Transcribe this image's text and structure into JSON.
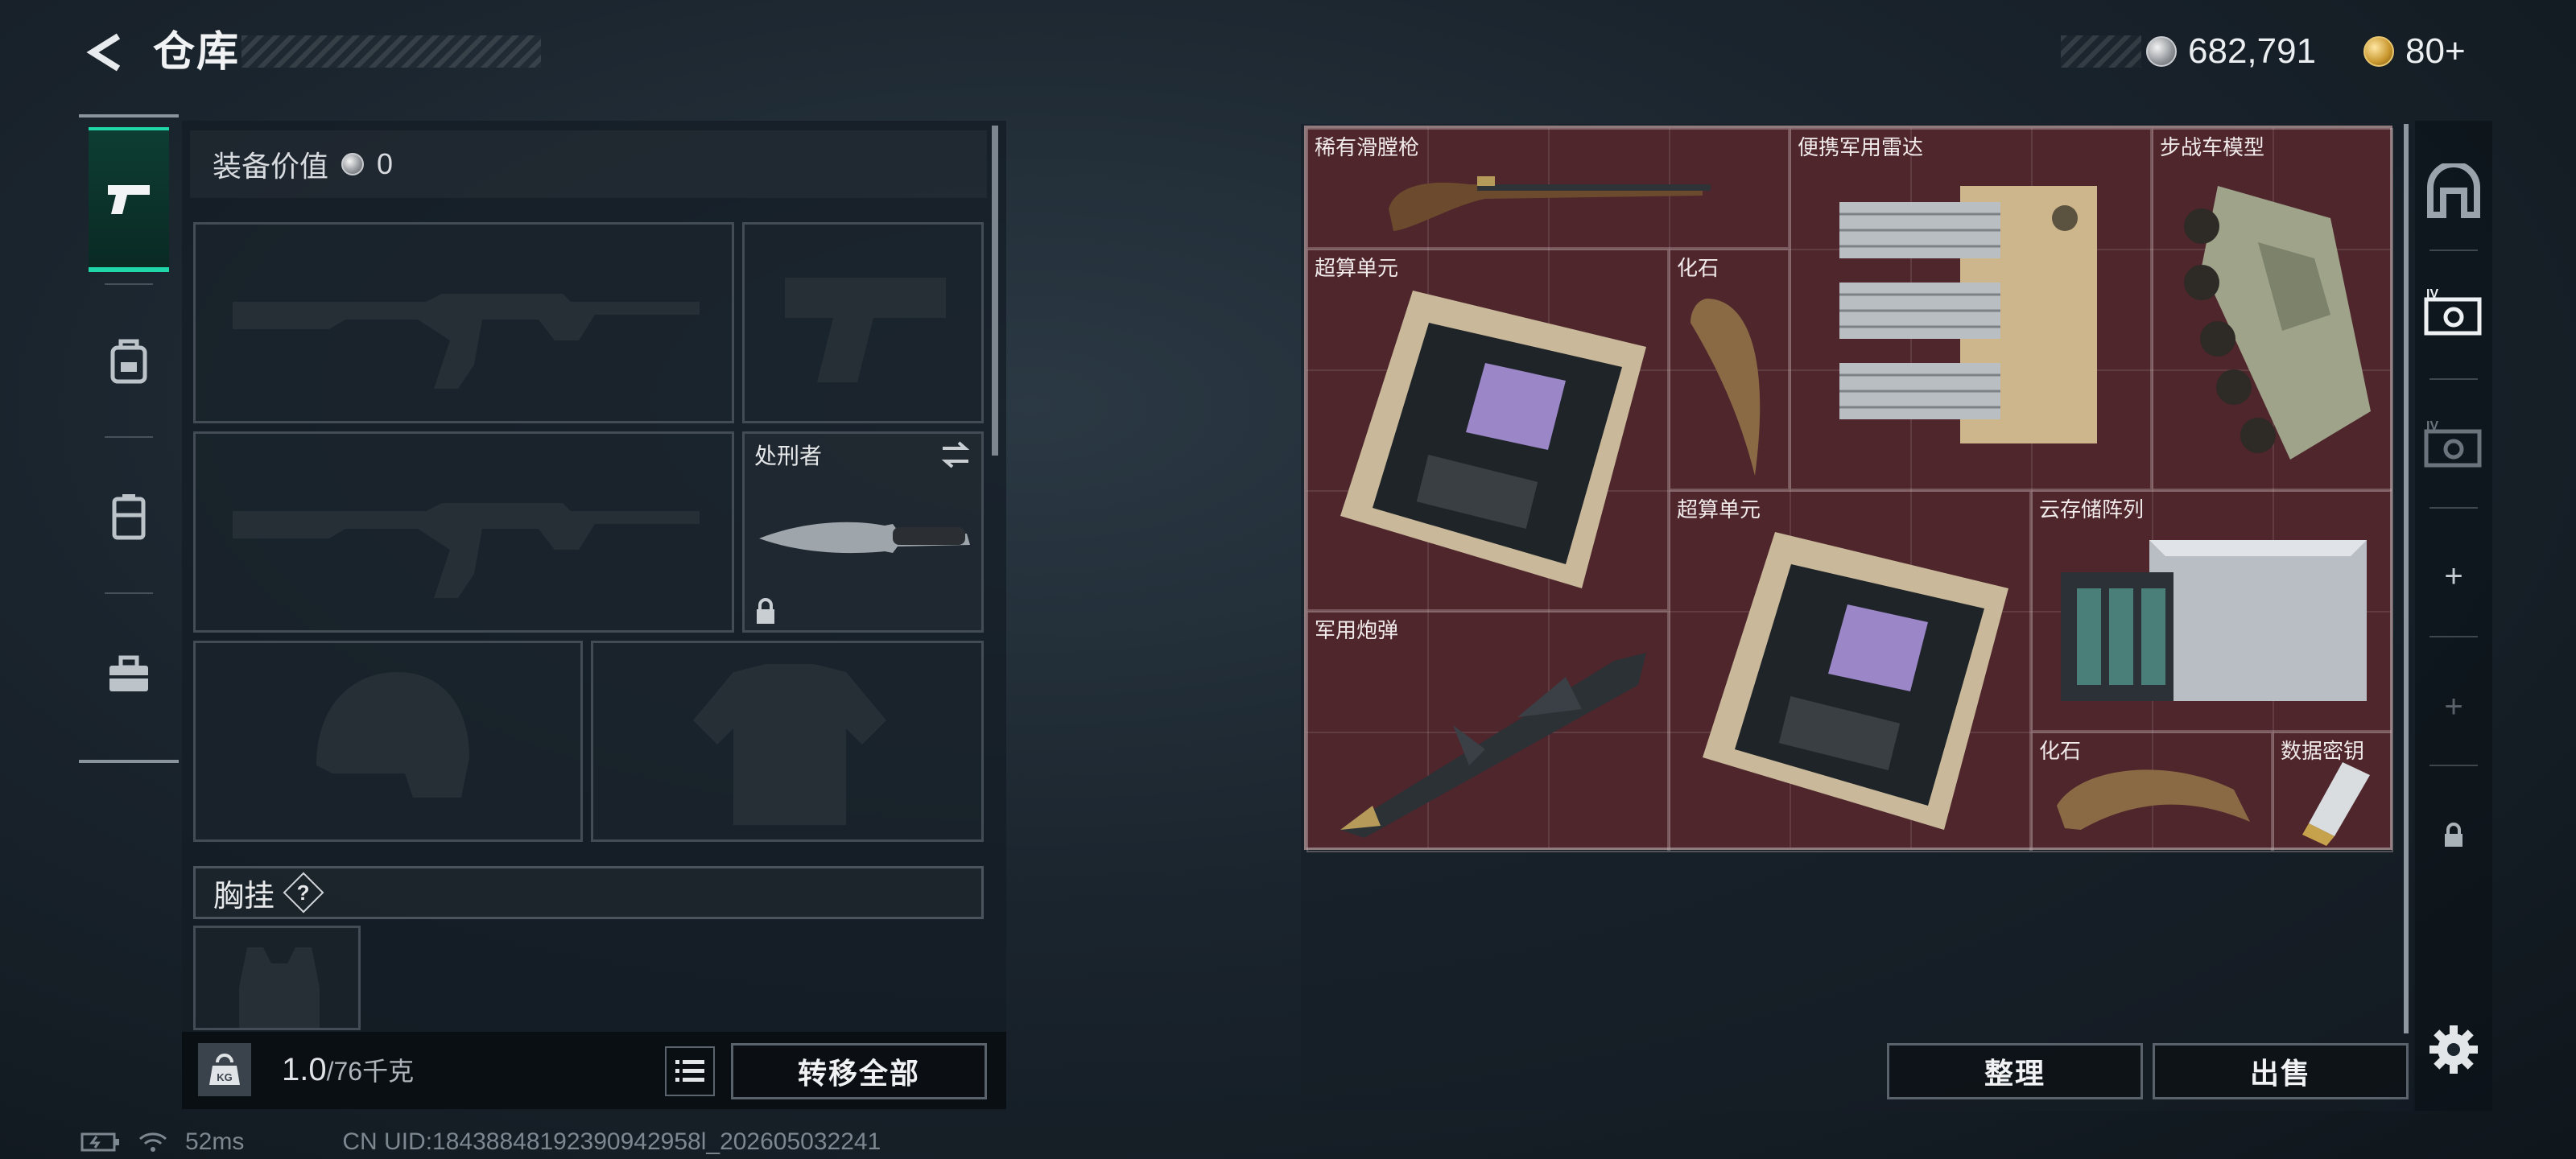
{
  "header": {
    "title": "仓库",
    "currency_silver": "682,791",
    "currency_gold": "80+"
  },
  "tabs": [
    {
      "name": "weapons",
      "icon": "pistol-icon",
      "active": true
    },
    {
      "name": "backpack",
      "icon": "backpack-icon",
      "active": false
    },
    {
      "name": "vest",
      "icon": "vest-icon",
      "active": false
    },
    {
      "name": "toolbox",
      "icon": "toolbox-icon",
      "active": false
    }
  ],
  "equipment": {
    "value_label": "装备价值",
    "value": "0",
    "melee_label": "处刑者",
    "chest_rig_label": "胸挂",
    "help_symbol": "?"
  },
  "footer": {
    "weight_icon_text": "KG",
    "weight_current": "1.0",
    "weight_max": "/76千克",
    "transfer_all": "转移全部",
    "sort": "整理",
    "sell": "出售"
  },
  "storage": {
    "items": [
      {
        "label": "稀有滑膛枪",
        "icon": "musket-icon"
      },
      {
        "label": "便携军用雷达",
        "icon": "radar-icon"
      },
      {
        "label": "步战车模型",
        "icon": "ifv-model-icon"
      },
      {
        "label": "超算单元",
        "icon": "compute-unit-icon"
      },
      {
        "label": "化石",
        "icon": "claw-fossil-icon"
      },
      {
        "label": "超算单元",
        "icon": "compute-unit-icon"
      },
      {
        "label": "云存储阵列",
        "icon": "storage-array-icon"
      },
      {
        "label": "军用炮弹",
        "icon": "missile-icon"
      },
      {
        "label": "化石",
        "icon": "fossil-icon"
      },
      {
        "label": "数据密钥",
        "icon": "data-key-icon"
      }
    ]
  },
  "side_rail": [
    {
      "icon": "safe-box-icon"
    },
    {
      "icon": "level-iv-case-icon",
      "text": "IV"
    },
    {
      "icon": "level-iv-case-dim-icon",
      "text": "IV"
    },
    {
      "icon": "add-icon",
      "text": "+"
    },
    {
      "icon": "add-dim-icon",
      "text": "+"
    },
    {
      "icon": "lock-icon"
    }
  ],
  "status": {
    "ping": "52ms",
    "uid": "CN UID:18438848192390942958l_202605032241"
  },
  "colors": {
    "accent": "#1fd7a8",
    "grid_bg": "#4e262c",
    "panel_bg": "#141c24"
  }
}
